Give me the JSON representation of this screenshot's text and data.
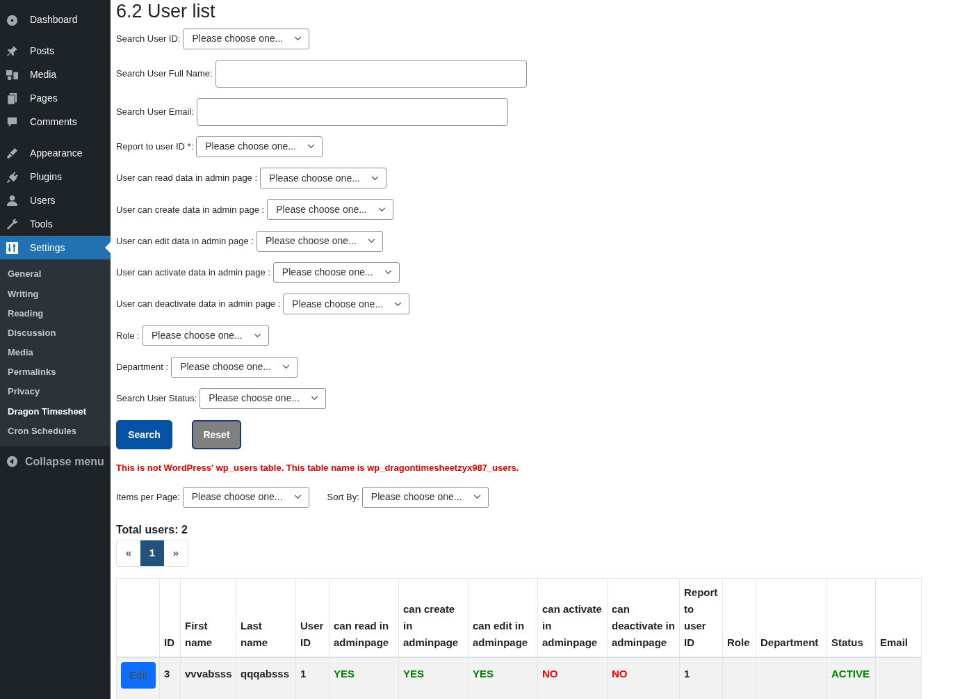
{
  "sidebar": {
    "items": [
      {
        "label": "Dashboard",
        "selected": false
      },
      {
        "label": "Posts",
        "selected": false
      },
      {
        "label": "Media",
        "selected": false
      },
      {
        "label": "Pages",
        "selected": false
      },
      {
        "label": "Comments",
        "selected": false
      },
      {
        "label": "Appearance",
        "selected": false
      },
      {
        "label": "Plugins",
        "selected": false
      },
      {
        "label": "Users",
        "selected": false
      },
      {
        "label": "Tools",
        "selected": false
      },
      {
        "label": "Settings",
        "selected": true
      }
    ],
    "submenu": [
      {
        "label": "General",
        "selected": false
      },
      {
        "label": "Writing",
        "selected": false
      },
      {
        "label": "Reading",
        "selected": false
      },
      {
        "label": "Discussion",
        "selected": false
      },
      {
        "label": "Media",
        "selected": false
      },
      {
        "label": "Permalinks",
        "selected": false
      },
      {
        "label": "Privacy",
        "selected": false
      },
      {
        "label": "Dragon Timesheet",
        "selected": true
      },
      {
        "label": "Cron Schedules",
        "selected": false
      }
    ],
    "collapse": "Collapse menu"
  },
  "title": "6.2 User list",
  "filters": [
    {
      "kind": "select",
      "label": "Search User ID:",
      "value": "Please choose one..."
    },
    {
      "kind": "text",
      "label": "Search User Full Name:"
    },
    {
      "kind": "text",
      "label": "Search User Email:"
    },
    {
      "kind": "select",
      "label": "Report to user ID *:",
      "value": "Please choose one..."
    },
    {
      "kind": "select",
      "label": "User can read data in admin page :",
      "value": "Please choose one..."
    },
    {
      "kind": "select",
      "label": "User can create data in admin page :",
      "value": "Please choose one..."
    },
    {
      "kind": "select",
      "label": "User can edit data in admin page :",
      "value": "Please choose one..."
    },
    {
      "kind": "select",
      "label": "User can activate data in admin page :",
      "value": "Please choose one..."
    },
    {
      "kind": "select",
      "label": "User can deactivate data in admin page :",
      "value": "Please choose one..."
    },
    {
      "kind": "select",
      "label": "Role :",
      "value": "Please choose one..."
    },
    {
      "kind": "select",
      "label": "Department :",
      "value": "Please choose one..."
    },
    {
      "kind": "select",
      "label": "Search User Status:",
      "value": "Please choose one..."
    }
  ],
  "buttons": [
    "Search",
    "Reset"
  ],
  "notice": "This is not WordPress' wp_users table. This table name is wp_dragontimesheetzyx987_users.",
  "list_controls": [
    {
      "label": "Items per Page:",
      "value": "Please choose one..."
    },
    {
      "label": "Sort By:",
      "value": "Please choose one..."
    }
  ],
  "total": "Total users: 2",
  "pagination": [
    {
      "label": "«",
      "selected": false
    },
    {
      "label": "1",
      "selected": true
    },
    {
      "label": "»",
      "selected": false
    }
  ],
  "table": {
    "columns": [
      "",
      "ID",
      "First name",
      "Last name",
      "User ID",
      "can read in adminpage",
      "can create in adminpage",
      "can edit in adminpage",
      "can activate in adminpage",
      "can deactivate in adminpage",
      "Report to user ID",
      "Role",
      "Department",
      "Status",
      "Email"
    ],
    "rows": [
      {
        "cells": [
          {
            "kind": "button",
            "text": "Edit"
          },
          {
            "text": "3"
          },
          {
            "text": "vvvabsss"
          },
          {
            "text": "qqqabsss"
          },
          {
            "text": "1"
          },
          {
            "text": "YES",
            "color": "#008000"
          },
          {
            "text": "YES",
            "color": "#008000"
          },
          {
            "text": "YES",
            "color": "#008000"
          },
          {
            "text": "NO",
            "color": "#ff0000"
          },
          {
            "text": "NO",
            "color": "#ff0000"
          },
          {
            "text": "1"
          },
          {},
          {},
          {
            "text": "ACTIVE",
            "color": "#008000"
          },
          {}
        ]
      }
    ]
  }
}
